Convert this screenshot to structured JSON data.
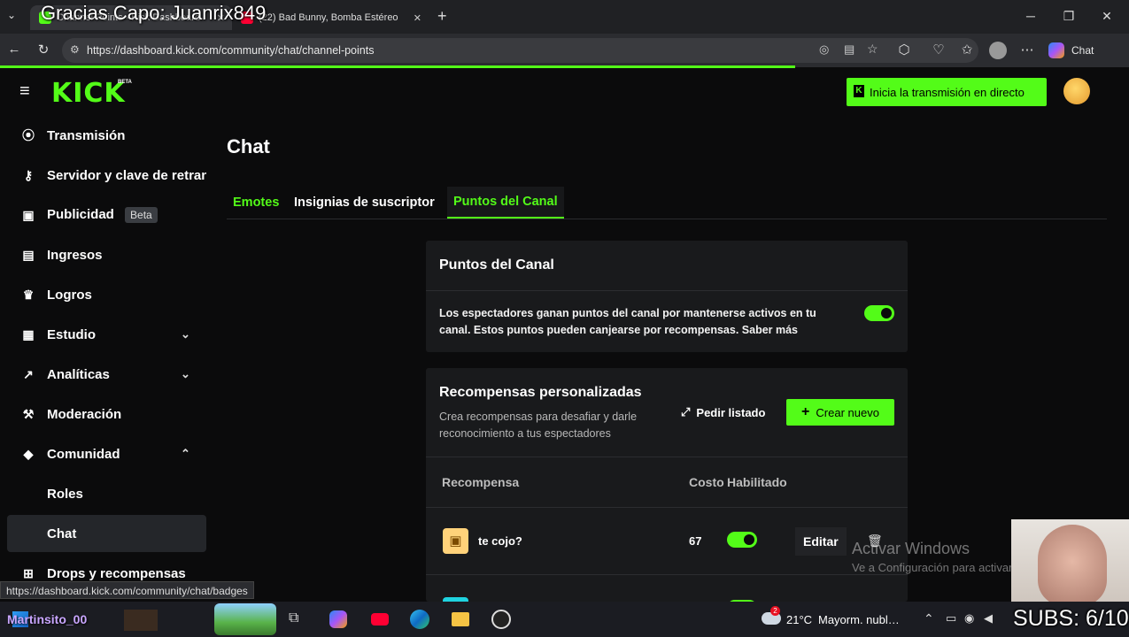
{
  "overlay": {
    "title": "Gracias Capo: Juanrix849",
    "subs_counter": "SUBS: 6/10",
    "streamer_name": "Martinsito_00"
  },
  "browser": {
    "tabs": [
      {
        "label": "Channel Points - Kick Dashboard"
      },
      {
        "label": "(22) Bad Bunny, Bomba Estéreo"
      }
    ],
    "url": "https://dashboard.kick.com/community/chat/channel-points",
    "copilot_label": "Chat",
    "status_link": "https://dashboard.kick.com/community/chat/badges"
  },
  "header": {
    "logo": "KICK",
    "logo_tag": "BETA",
    "go_live_label": "Inicia la transmisión en directo"
  },
  "sidebar": {
    "items": [
      {
        "label": "Transmisión",
        "icon": "broadcast-icon"
      },
      {
        "label": "Servidor y clave de retransmisión",
        "icon": "key-icon"
      },
      {
        "label": "Publicidad",
        "icon": "ad-icon",
        "badge": "Beta"
      },
      {
        "label": "Ingresos",
        "icon": "money-icon"
      },
      {
        "label": "Logros",
        "icon": "trophy-icon"
      },
      {
        "label": "Estudio",
        "icon": "studio-icon"
      },
      {
        "label": "Analíticas",
        "icon": "analytics-icon"
      },
      {
        "label": "Moderación",
        "icon": "hammer-icon"
      },
      {
        "label": "Comunidad",
        "icon": "community-icon"
      },
      {
        "label": "Roles"
      },
      {
        "label": "Chat"
      },
      {
        "label": "Drops y recompensas",
        "icon": "gift-icon"
      }
    ]
  },
  "main": {
    "title": "Chat",
    "tabs": [
      {
        "label": "Emotes"
      },
      {
        "label": "Insignias de suscriptor"
      },
      {
        "label": "Puntos del Canal"
      }
    ],
    "points_card": {
      "title": "Puntos del Canal",
      "description": "Los espectadores ganan puntos del canal por mantenerse activos en tu canal. Estos puntos pueden canjearse por recompensas. Saber más",
      "enabled": true
    },
    "rewards_card": {
      "title": "Recompensas personalizadas",
      "subtitle": "Crea recompensas para desafiar y darle reconocimiento a tus espectadores",
      "request_list_label": "Pedir listado",
      "create_label": "Crear nuevo",
      "columns": [
        "Recompensa",
        "Costo",
        "Habilitado"
      ],
      "rows": [
        {
          "name": "te cojo?",
          "cost": "67",
          "enabled": true,
          "edit_label": "Editar"
        }
      ]
    }
  },
  "watermark": {
    "line1": "Activar Windows",
    "line2": "Ve a Configuración para activar Windows."
  },
  "taskbar": {
    "weather_temp": "21°C",
    "weather_desc": "Mayorm. nublado",
    "notification_count": "2"
  },
  "colors": {
    "accent": "#53fc18",
    "background": "#0b0b0c",
    "card": "#191a1c"
  }
}
